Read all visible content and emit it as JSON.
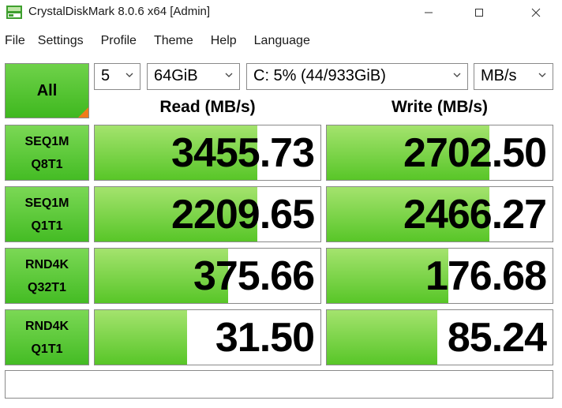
{
  "window": {
    "title": "CrystalDiskMark 8.0.6 x64 [Admin]"
  },
  "menu": [
    "File",
    "Settings",
    "Profile",
    "Theme",
    "Help",
    "Language"
  ],
  "controls": {
    "all_label": "All",
    "count": "5",
    "size": "64GiB",
    "drive": "C: 5% (44/933GiB)",
    "unit": "MB/s"
  },
  "headers": {
    "read": "Read (MB/s)",
    "write": "Write (MB/s)"
  },
  "tests": [
    {
      "line1": "SEQ1M",
      "line2": "Q8T1",
      "read": "3455.73",
      "write": "2702.50",
      "read_fill": 0.72,
      "write_fill": 0.72
    },
    {
      "line1": "SEQ1M",
      "line2": "Q1T1",
      "read": "2209.65",
      "write": "2466.27",
      "read_fill": 0.72,
      "write_fill": 0.72
    },
    {
      "line1": "RND4K",
      "line2": "Q32T1",
      "read": "375.66",
      "write": "176.68",
      "read_fill": 0.59,
      "write_fill": 0.54
    },
    {
      "line1": "RND4K",
      "line2": "Q1T1",
      "read": "31.50",
      "write": "85.24",
      "read_fill": 0.41,
      "write_fill": 0.49
    }
  ],
  "comment": "",
  "colors": {
    "green_top": "#7bd855",
    "green_bottom": "#44bc24",
    "fill_top": "#a4e36e",
    "fill_bottom": "#58c628",
    "corner_accent": "#f07a1a"
  }
}
